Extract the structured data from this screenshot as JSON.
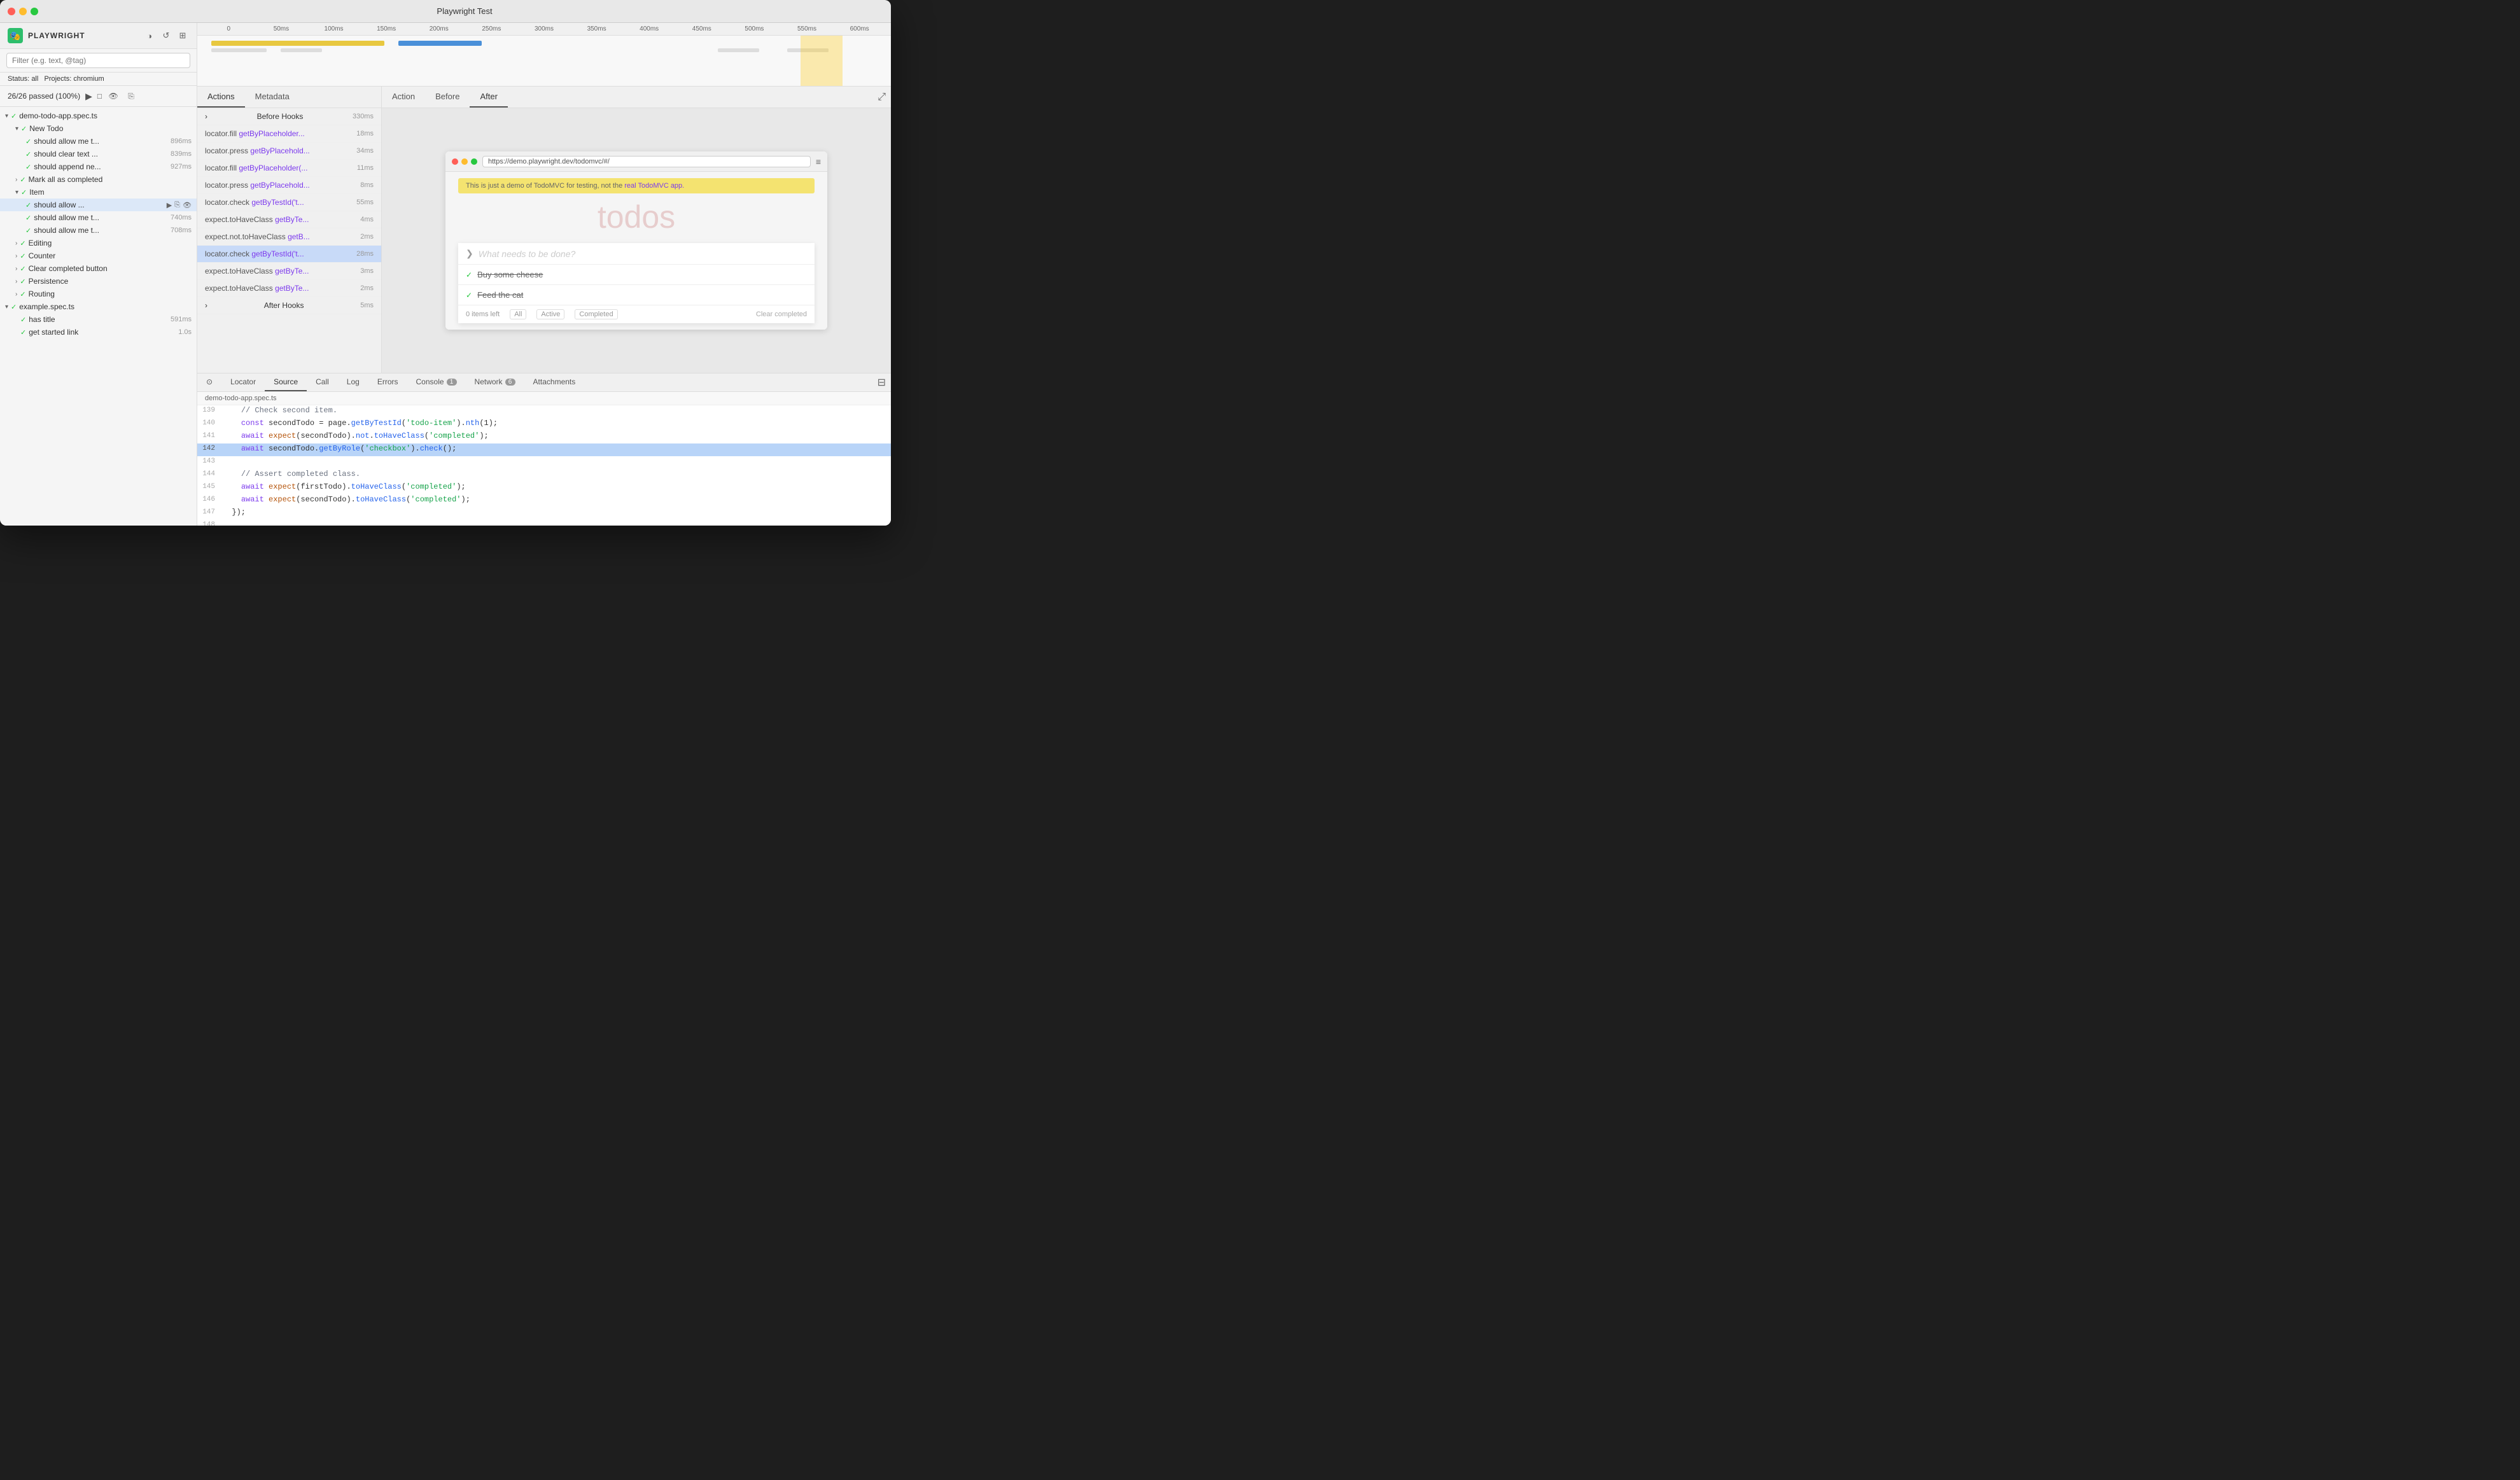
{
  "window": {
    "title": "Playwright Test",
    "traffic_lights": [
      "red",
      "yellow",
      "green"
    ]
  },
  "sidebar": {
    "logo": "🎭",
    "title": "PLAYWRIGHT",
    "search_placeholder": "Filter (e.g. text, @tag)",
    "status_label": "Status:",
    "status_value": "all",
    "projects_label": "Projects:",
    "projects_value": "chromium",
    "stats": "26/26 passed (100%)",
    "test_files": [
      {
        "name": "demo-todo-app.spec.ts",
        "groups": [
          {
            "name": "New Todo",
            "tests": [
              {
                "name": "should allow me t...",
                "duration": "896ms",
                "status": "pass"
              },
              {
                "name": "should clear text ...",
                "duration": "839ms",
                "status": "pass"
              },
              {
                "name": "should append ne...",
                "duration": "927ms",
                "status": "pass"
              }
            ]
          },
          {
            "name": "Mark all as completed",
            "tests": []
          },
          {
            "name": "Item",
            "tests": [
              {
                "name": "should allow ...",
                "duration": "",
                "status": "pass",
                "selected": true
              },
              {
                "name": "should allow me t...",
                "duration": "740ms",
                "status": "pass"
              },
              {
                "name": "should allow me t...",
                "duration": "708ms",
                "status": "pass"
              }
            ]
          },
          {
            "name": "Editing",
            "tests": []
          },
          {
            "name": "Counter",
            "tests": []
          },
          {
            "name": "Clear completed button",
            "tests": []
          },
          {
            "name": "Persistence",
            "tests": []
          },
          {
            "name": "Routing",
            "tests": []
          }
        ]
      },
      {
        "name": "example.spec.ts",
        "groups": [
          {
            "name": "",
            "tests": [
              {
                "name": "has title",
                "duration": "591ms",
                "status": "pass"
              },
              {
                "name": "get started link",
                "duration": "1.0s",
                "status": "pass"
              }
            ]
          }
        ]
      }
    ]
  },
  "timeline": {
    "markers": [
      "0",
      "50ms",
      "100ms",
      "150ms",
      "200ms",
      "250ms",
      "300ms",
      "350ms",
      "400ms",
      "450ms",
      "500ms",
      "550ms",
      "600ms"
    ]
  },
  "actions": {
    "tabs": [
      "Actions",
      "Metadata"
    ],
    "active_tab": "Actions",
    "items": [
      {
        "type": "group",
        "name": "Before Hooks",
        "duration": "330ms"
      },
      {
        "type": "action",
        "prefix": "locator.fill",
        "locator": "getByPlaceholder...",
        "duration": "18ms"
      },
      {
        "type": "action",
        "prefix": "locator.press",
        "locator": "getByPlacehold...",
        "duration": "34ms"
      },
      {
        "type": "action",
        "prefix": "locator.fill",
        "locator": "getByPlaceholder(... 11ms",
        "duration": "11ms"
      },
      {
        "type": "action",
        "prefix": "locator.press",
        "locator": "getByPlacehold...",
        "duration": "8ms"
      },
      {
        "type": "action",
        "prefix": "locator.check",
        "locator": "getByTestId('t...",
        "duration": "55ms"
      },
      {
        "type": "action",
        "prefix": "expect.toHaveClass",
        "locator": "getByTe...",
        "duration": "4ms"
      },
      {
        "type": "action",
        "prefix": "expect.not.toHaveClass",
        "locator": "getB...",
        "duration": "2ms"
      },
      {
        "type": "action",
        "prefix": "locator.check",
        "locator": "getByTestId('t...",
        "duration": "28ms",
        "selected": true
      },
      {
        "type": "action",
        "prefix": "expect.toHaveClass",
        "locator": "getByTe...",
        "duration": "3ms"
      },
      {
        "type": "action",
        "prefix": "expect.toHaveClass",
        "locator": "getByTe...",
        "duration": "2ms"
      },
      {
        "type": "group",
        "name": "After Hooks",
        "duration": "5ms"
      }
    ]
  },
  "preview": {
    "tabs": [
      "Action",
      "Before",
      "After"
    ],
    "active_tab": "After",
    "browser_url": "https://demo.playwright.dev/todomvc/#/",
    "banner_text": "This is just a demo of TodoMVC for testing, not the",
    "banner_link": "real TodoMVC app.",
    "todo_title": "todos",
    "todo_items": [
      {
        "text": "Buy some cheese",
        "completed": true
      },
      {
        "text": "Feed the cat",
        "completed": true
      }
    ],
    "footer": {
      "items_left": "0 items left",
      "filters": [
        "All",
        "Active",
        "Completed"
      ],
      "clear_btn": "Clear completed"
    }
  },
  "source": {
    "tabs": [
      "Locator",
      "Source",
      "Call",
      "Log",
      "Errors",
      "Console",
      "Network",
      "Attachments"
    ],
    "console_badge": "1",
    "network_badge": "6",
    "active_tab": "Source",
    "filename": "demo-todo-app.spec.ts",
    "lines": [
      {
        "num": "139",
        "text": "    // Check second item.",
        "highlight": false
      },
      {
        "num": "140",
        "text": "    const secondTodo = page.getByTestId('todo-item').nth(1);",
        "highlight": false
      },
      {
        "num": "141",
        "text": "    await expect(secondTodo).not.toHaveClass('completed');",
        "highlight": false
      },
      {
        "num": "142",
        "text": "    await secondTodo.getByRole('checkbox').check();",
        "highlight": true
      },
      {
        "num": "143",
        "text": "",
        "highlight": false
      },
      {
        "num": "144",
        "text": "    // Assert completed class.",
        "highlight": false
      },
      {
        "num": "145",
        "text": "    await expect(firstTodo).toHaveClass('completed');",
        "highlight": false
      },
      {
        "num": "146",
        "text": "    await expect(secondTodo).toHaveClass('completed');",
        "highlight": false
      },
      {
        "num": "147",
        "text": "  });",
        "highlight": false
      },
      {
        "num": "148",
        "text": "",
        "highlight": false
      }
    ]
  }
}
